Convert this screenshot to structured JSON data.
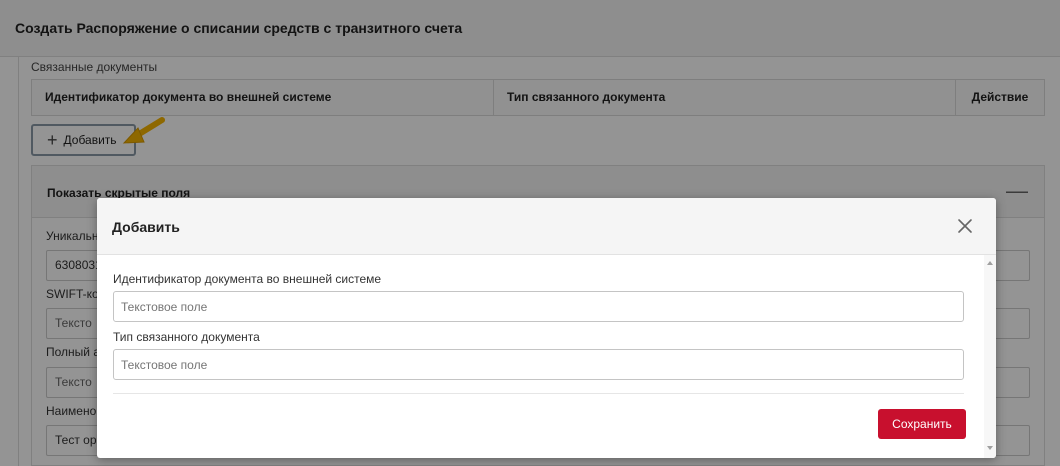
{
  "page": {
    "title": "Создать Распоряжение о списании средств с транзитного счета",
    "related_documents_label": "Связанные документы",
    "table_headers": {
      "external_id": "Идентификатор документа во внешней системе",
      "doc_type": "Тип связанного документа",
      "action": "Действие"
    },
    "add_button": "Добавить",
    "add_icon": "+",
    "hidden_fields_title": "Показать скрытые поля",
    "collapse_icon": "—",
    "labels": [
      "Уникальн",
      "SWIFT-ко",
      "Полный а",
      "Наимено"
    ],
    "fields": [
      "6308031",
      "Тексто",
      "Тексто",
      "Тест орг"
    ]
  },
  "modal": {
    "title": "Добавить",
    "fields": [
      {
        "label": "Идентификатор документа во внешней системе",
        "value": "",
        "placeholder": "Текстовое поле"
      },
      {
        "label": "Тип связанного документа",
        "value": "",
        "placeholder": "Текстовое поле"
      }
    ],
    "save_button": "Сохранить"
  },
  "colors": {
    "accent": "#c8102e",
    "arrow": "#f5b400",
    "overlay": "rgba(0,0,0,0.42)"
  },
  "icons": {
    "close": "close-icon",
    "add": "plus-icon",
    "collapse": "minus-icon",
    "annotation": "arrow-annotation-icon"
  }
}
